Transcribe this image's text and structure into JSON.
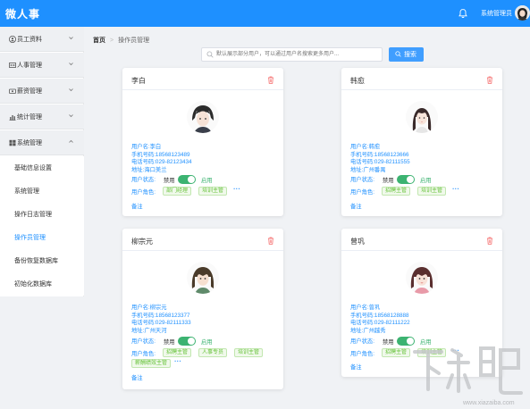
{
  "app": {
    "title": "微人事",
    "user": "系统管理员"
  },
  "sidebar": {
    "menus": [
      {
        "label": "员工资料"
      },
      {
        "label": "人事管理"
      },
      {
        "label": "薪资管理"
      },
      {
        "label": "统计管理"
      },
      {
        "label": "系统管理"
      }
    ],
    "sub_items": [
      {
        "label": "基础信息设置"
      },
      {
        "label": "系统管理"
      },
      {
        "label": "操作日志管理"
      },
      {
        "label": "操作员管理"
      },
      {
        "label": "备份恢复数据库"
      },
      {
        "label": "初始化数据库"
      }
    ]
  },
  "breadcrumb": {
    "home": "首页",
    "current": "操作员管理"
  },
  "search": {
    "placeholder": "默认展示部分用户，可以通过用户名搜索更多用户...",
    "button": "搜索"
  },
  "labels": {
    "disabled": "禁用",
    "enabled": "启用",
    "role": "用户角色:",
    "note": "备注"
  },
  "users": [
    {
      "name": "李白",
      "username": "用户名:李白",
      "phone": "手机号码:18568123489",
      "tel": "电话号码:029-82123434",
      "address": "地址:海口美兰",
      "status": "用户状态:",
      "roles": [
        "部门经理",
        "培训主管"
      ]
    },
    {
      "name": "韩愈",
      "username": "用户名:韩愈",
      "phone": "手机号码:18568123666",
      "tel": "电话号码:029-82111555",
      "address": "地址:广州番禺",
      "status": "用户状态:",
      "roles": [
        "招聘主管",
        "培训主管"
      ]
    },
    {
      "name": "柳宗元",
      "username": "用户名:柳宗元",
      "phone": "手机号码:18568123377",
      "tel": "电话号码:029-82111333",
      "address": "地址:广州天河",
      "status": "用户状态:",
      "roles": [
        "招聘主管",
        "人事专员",
        "培训主管",
        "薪酬绩效主管"
      ]
    },
    {
      "name": "曾巩",
      "username": "用户名:曾巩",
      "phone": "手机号码:18568128888",
      "tel": "电话号码:029-82111222",
      "address": "地址:广州越秀",
      "status": "用户状态:",
      "roles": [
        "招聘主管",
        "培训主管"
      ]
    }
  ],
  "colors": {
    "primary": "#1e90ff",
    "success": "#3cb371",
    "tag_text": "#67c23a"
  },
  "watermark": {
    "text": "下载吧",
    "url": "www.xiazaiba.com"
  }
}
